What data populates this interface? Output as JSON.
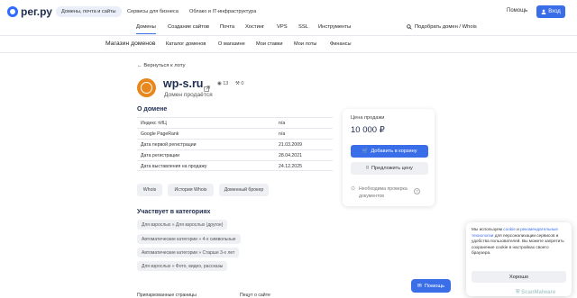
{
  "header": {
    "logo": "рег.ру",
    "tabs": [
      "Домены, почта и сайты",
      "Сервисы для бизнеса",
      "Облако и IT-инфраструктура"
    ],
    "help": "Помощь",
    "login": "Вход"
  },
  "nav": {
    "items": [
      "Домены",
      "Создание сайтов",
      "Почта",
      "Хостинг",
      "VPS",
      "SSL",
      "Инструменты"
    ],
    "pick_domain": "Подобрать домен / Whois"
  },
  "subnav": {
    "title": "Магазин доменов",
    "items": [
      "Каталог доменов",
      "О магазине",
      "Мои ставки",
      "Мои лоты",
      "Финансы"
    ]
  },
  "domain": {
    "back": "Вернуться к лоту",
    "name": "wp-s.ru",
    "views": "13",
    "bids": "0",
    "status": "Домен продаётся"
  },
  "about": {
    "title": "О домене",
    "rows": [
      {
        "label": "Индекс тИЦ",
        "value": "n/a"
      },
      {
        "label": "Google PageRank",
        "value": "n/a"
      },
      {
        "label": "Дата первой регистрации",
        "value": "21.03.2009"
      },
      {
        "label": "Дата регистрации",
        "value": "28.04.2021"
      },
      {
        "label": "Дата выставления на продажу",
        "value": "24.12.2025"
      }
    ],
    "buttons": [
      "Whois",
      "История Whois",
      "Доменный брокер"
    ]
  },
  "categories": {
    "title": "Участвует в категориях",
    "items": [
      "Для взрослых » Для взрослых (другое)",
      "Автоматические категории » 4-х символьные",
      "Автоматические категории » Старше 3-х лет",
      "Для взрослых » Фото, видео, рассказы"
    ]
  },
  "footer": {
    "left": "Припаркованные страницы",
    "right": "Пецут о сайте"
  },
  "sale": {
    "label": "Цена продажи",
    "price": "10 000 ₽",
    "cart": "Добавить в корзину",
    "offer": "Предложить цену",
    "whois_check": "Необходима проверка документов"
  },
  "help_button": "Помощь",
  "cookie": {
    "t1": "Мы используем ",
    "link1": "cookie",
    "t2": " и ",
    "link2": "рекомендательные технологии",
    "t3": " для персонализации сервисов и удобства пользователей. Вы можете запретить сохранение cookie в настройках своего браузера.",
    "ok": "Хорошо"
  },
  "watermark": "ScanMalware",
  "colors": {
    "accent": "#3a6ee8",
    "logo": "#1f2d4f",
    "globe": "#e8871c"
  }
}
